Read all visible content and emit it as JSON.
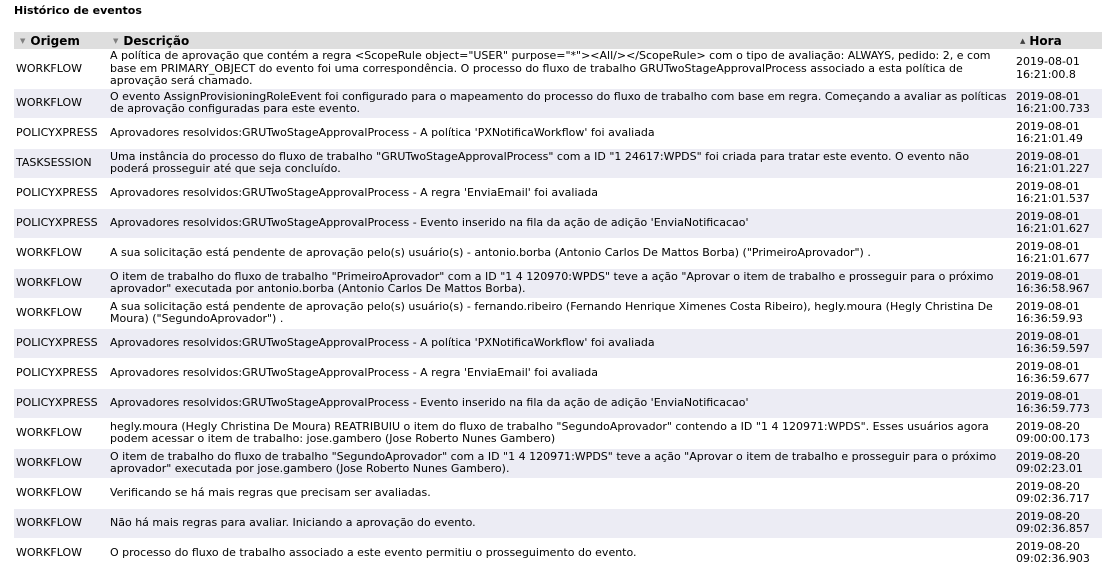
{
  "panel": {
    "title": "Histórico de eventos"
  },
  "table": {
    "columns": {
      "origem": "Origem",
      "descricao": "Descrição",
      "hora": "Hora"
    },
    "sort_icons": {
      "origem": "▼",
      "descricao": "▼",
      "hora": "▲"
    },
    "rows": [
      {
        "origem": "WORKFLOW",
        "descricao": "A política de aprovação que contém a regra <ScopeRule object=\"USER\" purpose=\"*\"><All/></ScopeRule> com o tipo de avaliação: ALWAYS, pedido: 2, e com base em PRIMARY_OBJECT do evento foi uma correspondência. O processo do fluxo de trabalho GRUTwoStageApprovalProcess associado a esta política de aprovação será chamado.",
        "hora": "2019-08-01\n16:21:00.8"
      },
      {
        "origem": "WORKFLOW",
        "descricao": "O evento AssignProvisioningRoleEvent foi configurado para o mapeamento do processo do fluxo de trabalho com base em regra. Começando a avaliar as políticas de aprovação configuradas para este evento.",
        "hora": "2019-08-01\n16:21:00.733"
      },
      {
        "origem": "POLICYXPRESS",
        "descricao": "Aprovadores resolvidos:GRUTwoStageApprovalProcess - A política 'PXNotificaWorkflow' foi avaliada",
        "hora": "2019-08-01\n16:21:01.49"
      },
      {
        "origem": "TASKSESSION",
        "descricao": "Uma instância do processo do fluxo de trabalho \"GRUTwoStageApprovalProcess\" com a ID \"1 24617:WPDS\" foi criada para tratar este evento. O evento não poderá prosseguir até que seja concluído.",
        "hora": "2019-08-01\n16:21:01.227"
      },
      {
        "origem": "POLICYXPRESS",
        "descricao": "Aprovadores resolvidos:GRUTwoStageApprovalProcess - A regra 'EnviaEmail' foi avaliada",
        "hora": "2019-08-01\n16:21:01.537"
      },
      {
        "origem": "POLICYXPRESS",
        "descricao": "Aprovadores resolvidos:GRUTwoStageApprovalProcess - Evento inserido na fila da ação de adição 'EnviaNotificacao'",
        "hora": "2019-08-01\n16:21:01.627"
      },
      {
        "origem": "WORKFLOW",
        "descricao": "A sua solicitação está pendente de aprovação pelo(s) usuário(s) - antonio.borba (Antonio Carlos De Mattos Borba) (\"PrimeiroAprovador\") .",
        "hora": "2019-08-01\n16:21:01.677"
      },
      {
        "origem": "WORKFLOW",
        "descricao": "O item de trabalho do fluxo de trabalho \"PrimeiroAprovador\" com a ID \"1 4 120970:WPDS\" teve a ação \"Aprovar o item de trabalho e prosseguir para o próximo aprovador\" executada por antonio.borba (Antonio Carlos De Mattos Borba).",
        "hora": "2019-08-01\n16:36:58.967"
      },
      {
        "origem": "WORKFLOW",
        "descricao": "A sua solicitação está pendente de aprovação pelo(s) usuário(s) - fernando.ribeiro (Fernando Henrique Ximenes Costa Ribeiro), hegly.moura (Hegly Christina De Moura) (\"SegundoAprovador\") .",
        "hora": "2019-08-01\n16:36:59.93"
      },
      {
        "origem": "POLICYXPRESS",
        "descricao": "Aprovadores resolvidos:GRUTwoStageApprovalProcess - A política 'PXNotificaWorkflow' foi avaliada",
        "hora": "2019-08-01\n16:36:59.597"
      },
      {
        "origem": "POLICYXPRESS",
        "descricao": "Aprovadores resolvidos:GRUTwoStageApprovalProcess - A regra 'EnviaEmail' foi avaliada",
        "hora": "2019-08-01\n16:36:59.677"
      },
      {
        "origem": "POLICYXPRESS",
        "descricao": "Aprovadores resolvidos:GRUTwoStageApprovalProcess - Evento inserido na fila da ação de adição 'EnviaNotificacao'",
        "hora": "2019-08-01\n16:36:59.773"
      },
      {
        "origem": "WORKFLOW",
        "descricao": "hegly.moura (Hegly Christina De Moura) REATRIBUIU o item do fluxo de trabalho \"SegundoAprovador\" contendo a ID \"1 4 120971:WPDS\". Esses usuários agora podem acessar o item de trabalho: jose.gambero (Jose Roberto Nunes Gambero)",
        "hora": "2019-08-20\n09:00:00.173"
      },
      {
        "origem": "WORKFLOW",
        "descricao": "O item de trabalho do fluxo de trabalho \"SegundoAprovador\" com a ID \"1 4 120971:WPDS\" teve a ação \"Aprovar o item de trabalho e prosseguir para o próximo aprovador\" executada por jose.gambero (Jose Roberto Nunes Gambero).",
        "hora": "2019-08-20\n09:02:23.01"
      },
      {
        "origem": "WORKFLOW",
        "descricao": "Verificando se há mais regras que precisam ser avaliadas.",
        "hora": "2019-08-20\n09:02:36.717"
      },
      {
        "origem": "WORKFLOW",
        "descricao": "Não há mais regras para avaliar. Iniciando a aprovação do evento.",
        "hora": "2019-08-20\n09:02:36.857"
      },
      {
        "origem": "WORKFLOW",
        "descricao": "O processo do fluxo de trabalho associado a este evento permitiu o prosseguimento do evento.",
        "hora": "2019-08-20\n09:02:36.903"
      }
    ]
  }
}
